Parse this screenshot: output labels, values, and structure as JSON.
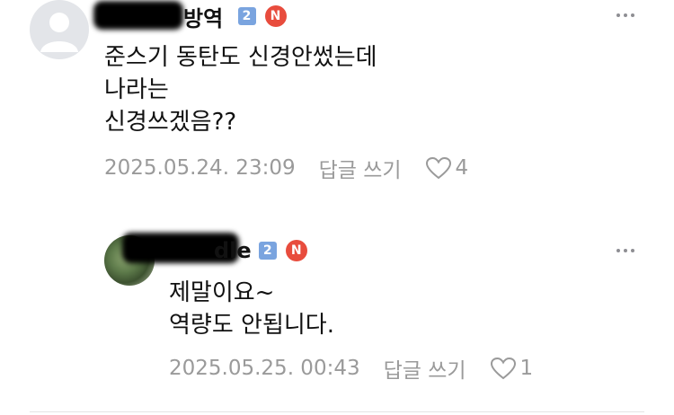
{
  "comments": [
    {
      "username": "방역",
      "grade_badge": "2",
      "new_badge": "N",
      "body": "준스기 동탄도 신경안썼는데\n나라는\n신경쓰겠음??",
      "timestamp": "2025.05.24. 23:09",
      "reply_label": "답글 쓰기",
      "like_count": "4"
    },
    {
      "username": "dle",
      "grade_badge": "2",
      "new_badge": "N",
      "body": "제말이요~\n역량도 안됩니다.",
      "timestamp": "2025.05.25. 00:43",
      "reply_label": "답글 쓰기",
      "like_count": "1"
    }
  ],
  "colors": {
    "grade_badge": "#7aa4df",
    "new_badge": "#e84c3d",
    "meta_text": "#9a9a9a"
  },
  "icons": {
    "more": "more-dots-icon",
    "like": "heart-icon",
    "avatar_default": "default-avatar-icon"
  }
}
